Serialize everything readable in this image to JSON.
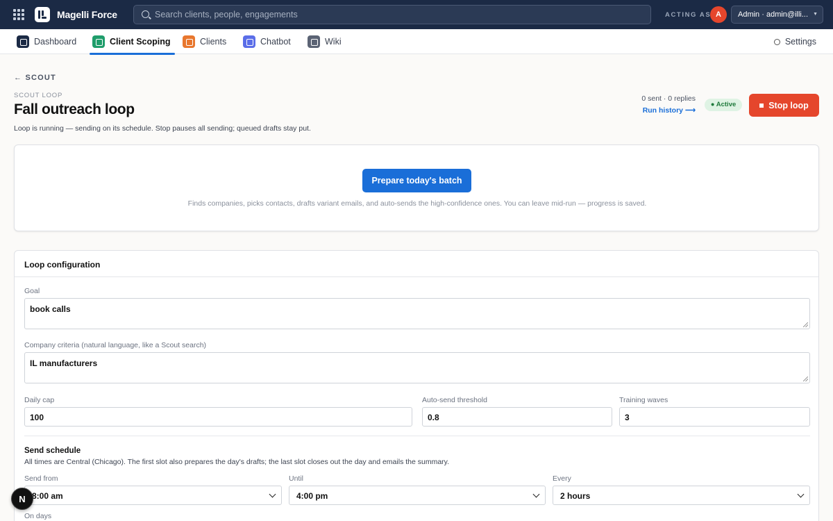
{
  "topbar": {
    "brand": "Magelli Force",
    "search_placeholder": "Search clients, people, engagements",
    "acting_as_label": "ACTING AS",
    "avatar_initial": "A",
    "user_select_value": "Admin · admin@illi..."
  },
  "nav": {
    "tabs": [
      {
        "label": "Dashboard",
        "icon": "dashboard-icon",
        "color": "#1b2a45"
      },
      {
        "label": "Client Scoping",
        "icon": "briefcase-icon",
        "color": "#1f9d6b",
        "active": true
      },
      {
        "label": "Clients",
        "icon": "clients-icon",
        "color": "#e8772e"
      },
      {
        "label": "Chatbot",
        "icon": "chat-icon",
        "color": "#5b6ee8"
      },
      {
        "label": "Wiki",
        "icon": "wiki-icon",
        "color": "#5b6374"
      }
    ],
    "settings_label": "Settings"
  },
  "header": {
    "back_label": "← SCOUT",
    "overline": "SCOUT LOOP",
    "title": "Fall outreach loop",
    "subtitle": "Loop is running — sending on its schedule. Stop pauses all sending; queued drafts stay put.",
    "stats": "0 sent · 0 replies",
    "run_history": "Run history ⟶",
    "status_badge": "● Active",
    "stop_button": "Stop loop"
  },
  "batch": {
    "button": "Prepare today's batch",
    "note": "Finds companies, picks contacts, drafts variant emails, and auto-sends the high-confidence ones. You can leave mid-run — progress is saved."
  },
  "config": {
    "title": "Loop configuration",
    "goal_label": "Goal",
    "goal_value": "book calls",
    "criteria_label": "Company criteria (natural language, like a Scout search)",
    "criteria_value": "IL manufacturers",
    "daily_cap_label": "Daily cap",
    "daily_cap_value": "100",
    "threshold_label": "Auto-send threshold",
    "threshold_value": "0.8",
    "waves_label": "Training waves",
    "waves_value": "3",
    "schedule_title": "Send schedule",
    "schedule_note": "All times are Central (Chicago). The first slot also prepares the day's drafts; the last slot closes out the day and emails the summary.",
    "send_from_label": "Send from",
    "send_from_value": "8:00 am",
    "until_label": "Until",
    "until_value": "4:00 pm",
    "every_label": "Every",
    "every_value": "2 hours",
    "on_days_label": "On days"
  },
  "floating_badge": "N",
  "colors": {
    "topbar": "#1b2a45",
    "accent": "#1a6ed8",
    "danger": "#e5462c",
    "success_bg": "#dff3e4",
    "success_text": "#1f7a3c"
  }
}
